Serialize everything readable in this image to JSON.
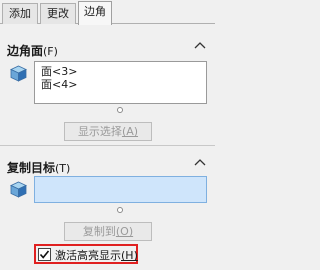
{
  "tabs": [
    {
      "label": "添加",
      "active": false
    },
    {
      "label": "更改",
      "active": false
    },
    {
      "label": "边角",
      "active": true
    }
  ],
  "corner_faces": {
    "title": "边角面",
    "shortcut": "(F)",
    "items": [
      "面<3>",
      "面<4>"
    ],
    "show_selection_button": "显示选择",
    "show_selection_key": "(A)"
  },
  "copy_target": {
    "title": "复制目标",
    "shortcut": "(T)",
    "copy_to_button": "复制到",
    "copy_to_key": "(O)"
  },
  "highlight_checkbox": {
    "label": "激活高亮显示",
    "key": "(H)",
    "checked": true
  },
  "colors": {
    "highlight_border": "#e02020",
    "selection_box": "#cfe5fb"
  }
}
